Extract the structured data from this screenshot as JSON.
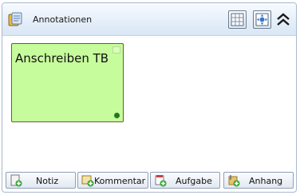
{
  "panel": {
    "title": "Annotationen",
    "header_buttons": [
      "grid-icon",
      "fit-view-icon"
    ],
    "collapse_icon": "double-chevron-up-icon"
  },
  "note": {
    "title": "Anschreiben TB",
    "color": "#c7fc9c",
    "status_color": "#1f7a1f"
  },
  "footer": {
    "buttons": [
      {
        "label": "Notiz",
        "icon": "note-add-icon"
      },
      {
        "label": "Kommentar",
        "icon": "comment-add-icon"
      },
      {
        "label": "Aufgabe",
        "icon": "task-add-icon"
      },
      {
        "label": "Anhang",
        "icon": "attachment-add-icon"
      }
    ]
  }
}
